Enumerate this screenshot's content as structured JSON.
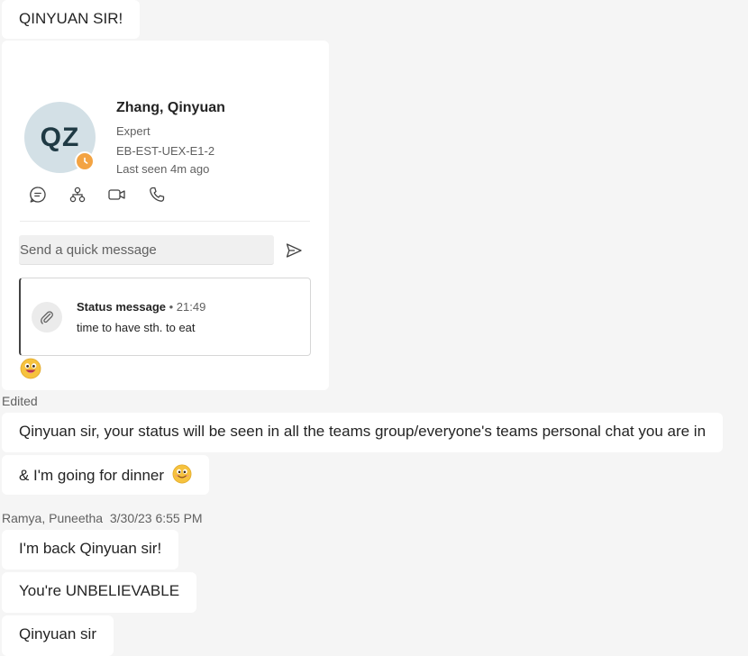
{
  "messages_top": {
    "first": "QINYUAN SIR!"
  },
  "profile_card": {
    "initials": "QZ",
    "name": "Zhang, Qinyuan",
    "role": "Expert",
    "department": "EB-EST-UEX-E1-2",
    "last_seen": "Last seen 4m ago",
    "presence": "away",
    "actions": [
      "chat-icon",
      "org-chart-icon",
      "video-call-icon",
      "phone-icon"
    ],
    "quick_message_placeholder": "Send a quick message",
    "status": {
      "label": "Status message",
      "time": "21:49",
      "text": "time to have sth. to eat"
    },
    "reaction": "grinning-face-emoji"
  },
  "edited_label": "Edited",
  "messages_after": {
    "status_note": "Qinyuan sir, your status will be seen in all the teams group/everyone's teams personal chat you are in",
    "dinner": "& I'm going for dinner"
  },
  "sender_header": {
    "name": "Ramya, Puneetha",
    "timestamp": "3/30/23 6:55 PM"
  },
  "messages_last": [
    "I'm back Qinyuan sir!",
    "You're UNBELIEVABLE",
    "Qinyuan sir"
  ],
  "colors": {
    "background": "#f5f5f5",
    "bubble": "#ffffff",
    "presence_away": "#f3a342",
    "avatar_bg": "#d3e0e6"
  }
}
